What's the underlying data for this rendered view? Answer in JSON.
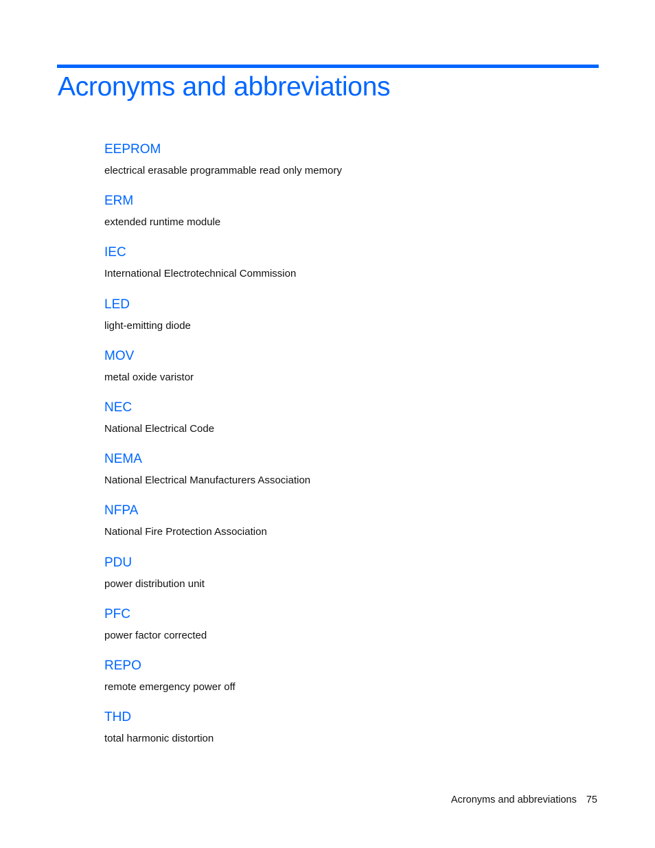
{
  "page": {
    "title": "Acronyms and abbreviations",
    "accent_color": "#0066ff",
    "entries": [
      {
        "term": "EEPROM",
        "definition": "electrical erasable programmable read only memory"
      },
      {
        "term": "ERM",
        "definition": "extended runtime module"
      },
      {
        "term": "IEC",
        "definition": "International Electrotechnical Commission"
      },
      {
        "term": "LED",
        "definition": "light-emitting diode"
      },
      {
        "term": "MOV",
        "definition": "metal oxide varistor"
      },
      {
        "term": "NEC",
        "definition": "National Electrical Code"
      },
      {
        "term": "NEMA",
        "definition": "National Electrical Manufacturers Association"
      },
      {
        "term": "NFPA",
        "definition": "National Fire Protection Association"
      },
      {
        "term": "PDU",
        "definition": "power distribution unit"
      },
      {
        "term": "PFC",
        "definition": "power factor corrected"
      },
      {
        "term": "REPO",
        "definition": "remote emergency power off"
      },
      {
        "term": "THD",
        "definition": "total harmonic distortion"
      }
    ]
  },
  "footer": {
    "section": "Acronyms and abbreviations",
    "page_number": "75"
  }
}
